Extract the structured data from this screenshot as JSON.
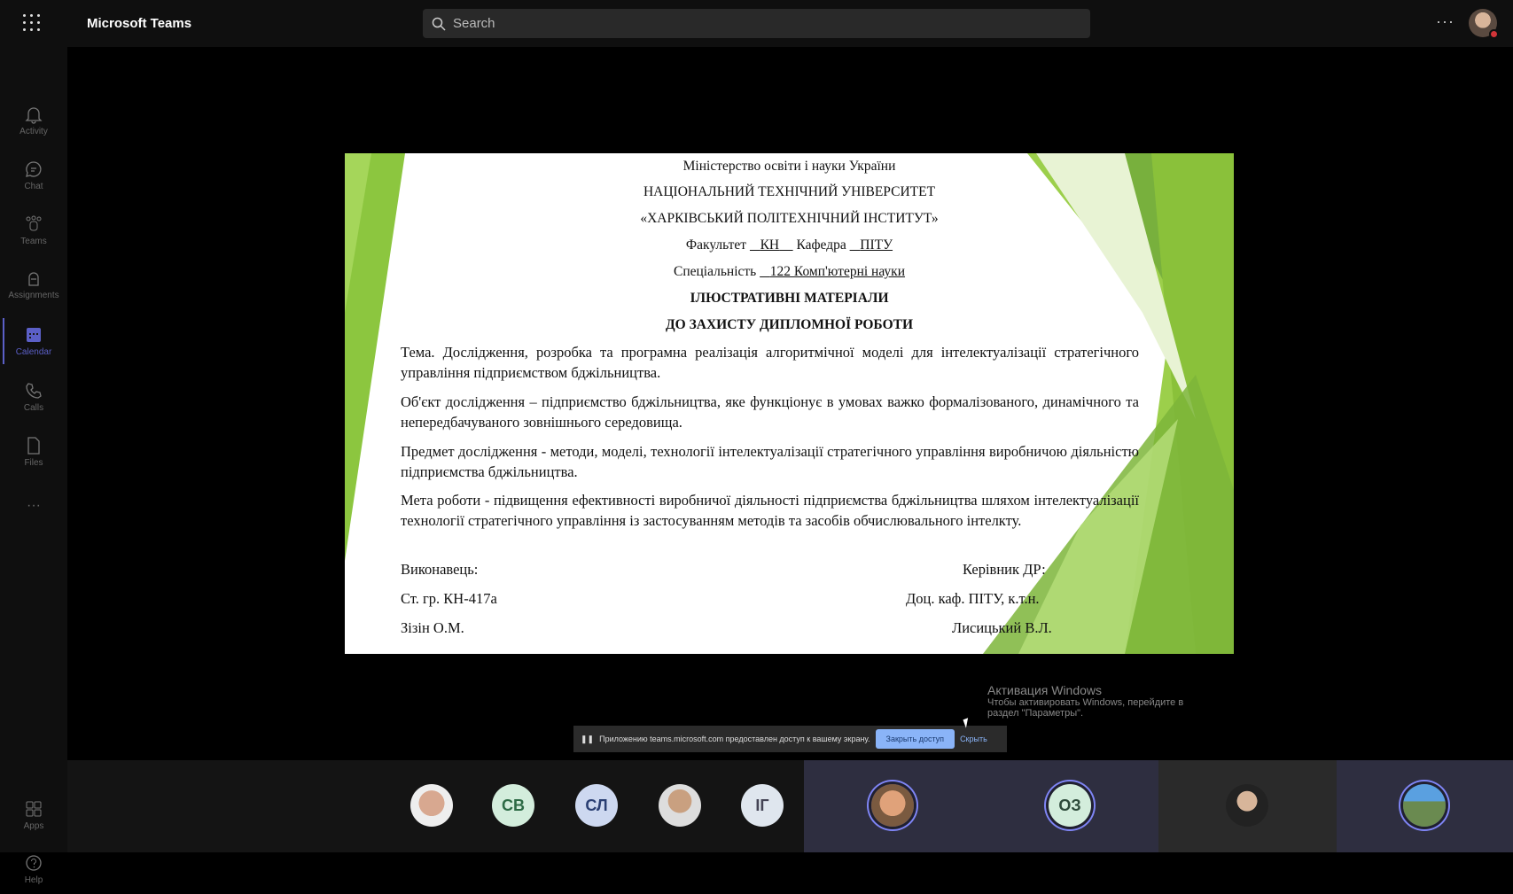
{
  "app": {
    "title": "Microsoft Teams",
    "search_placeholder": "Search",
    "more": "···"
  },
  "sidebar": {
    "items": [
      {
        "label": "Activity"
      },
      {
        "label": "Chat"
      },
      {
        "label": "Teams"
      },
      {
        "label": "Assignments"
      },
      {
        "label": "Calendar"
      },
      {
        "label": "Calls"
      },
      {
        "label": "Files"
      },
      {
        "label": "···"
      },
      {
        "label": "Apps"
      },
      {
        "label": "Help"
      }
    ]
  },
  "slide": {
    "ministry": "Міністерство освіти і науки України",
    "university1": "НАЦІОНАЛЬНИЙ ТЕХНІЧНИЙ УНІВЕРСИТЕТ",
    "university2": "«ХАРКІВСЬКИЙ ПОЛІТЕХНІЧНИЙ ІНСТИТУТ»",
    "faculty_label": "Факультет",
    "faculty": "КН",
    "department_label": "Кафедра",
    "department": "ПІТУ",
    "specialty_label": "Спеціальність",
    "specialty": "122   Комп'ютерні науки",
    "heading1": "ІЛЮСТРАТИВНІ МАТЕРІАЛИ",
    "heading2": "ДО ЗАХИСТУ ДИПЛОМНОЇ РОБОТИ",
    "topic": "Тема. Дослідження, розробка та програмна реалізація алгоритмічної моделі для інтелектуалізації стратегічного управління підприємством бджільництва.",
    "object": "Об'єкт дослідження – підприємство бджільництва, яке функціонує в умовах важко формалізованого, динамічного та непередбачуваного зовнішнього середовища.",
    "subject": "Предмет дослідження - методи, моделі, технології інтелектуалізації стратегічного управління виробничою діяльністю підприємства бджільництва.",
    "goal": "Мета роботи - підвищення ефективності виробничої діяльності підприємства бджільництва шляхом інтелектуалізації технології стратегічного управління із застосуванням методів та засобів обчислювального інтелкту.",
    "performer_label": "Виконавець:",
    "group": "Ст. гр. КН-417а",
    "student": "Зізін О.М.",
    "supervisor_label": "Керівник ДР:",
    "supervisor_title": "Доц. каф. ПІТУ, к.т.н.",
    "supervisor": "Лисицький В.Л."
  },
  "share_banner": {
    "text": "Приложению teams.microsoft.com предоставлен доступ к вашему экрану.",
    "stop": "Закрыть доступ",
    "hide": "Скрыть"
  },
  "watermark": {
    "title": "Активация Windows",
    "line1": "Чтобы активировать Windows, перейдите в",
    "line2": "раздел \"Параметры\"."
  },
  "participants": [
    {
      "initials": ""
    },
    {
      "initials": "СВ"
    },
    {
      "initials": "СЛ"
    },
    {
      "initials": ""
    },
    {
      "initials": "ІГ"
    },
    {
      "initials": ""
    },
    {
      "initials": "ОЗ"
    },
    {
      "initials": ""
    },
    {
      "initials": ""
    }
  ]
}
